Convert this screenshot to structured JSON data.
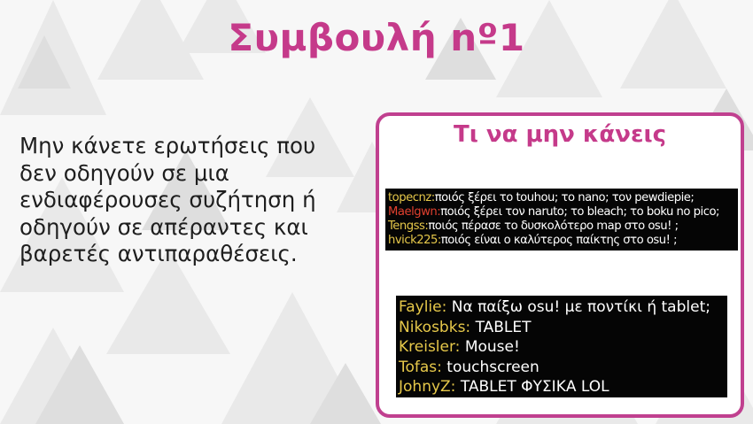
{
  "slide": {
    "title": "Συμβουλή nº1",
    "body_lines": [
      "Μην κάνετε ερωτήσεις που",
      "δεν οδηγούν σε μια",
      "ενδιαφέρουσες συζήτηση ή",
      "οδηγούν σε απέραντες και",
      "βαρετές αντιπαραθέσεις."
    ]
  },
  "panel": {
    "title": "Τι να μην κάνεις",
    "chat1": [
      {
        "user": "topecnz:",
        "color": "#e6c84a",
        "message": "ποιός ξέρει το touhou; το nano; τον pewdiepie;"
      },
      {
        "user": "Maelgwn:",
        "color": "#e0402f",
        "message": "ποιός ξέρει τον naruto; το bleach; το boku no pico;"
      },
      {
        "user": "Tengss:",
        "color": "#e6c84a",
        "message": "ποιός πέρασε το δυσκολότερο map στο osu! ;"
      },
      {
        "user": "hvick225:",
        "color": "#e6c84a",
        "message": "ποιός είναι ο καλύτερος παίκτης στο osu! ;"
      }
    ],
    "chat2": [
      {
        "user": "Faylie:",
        "color": "#e6c84a",
        "message": "Να παίξω osu! με ποντίκι ή tablet;"
      },
      {
        "user": "Nikosbks:",
        "color": "#e6c84a",
        "message": "TABLET"
      },
      {
        "user": "Kreisler:",
        "color": "#e6c84a",
        "message": "Mouse!"
      },
      {
        "user": "Tofas:",
        "color": "#e6c84a",
        "message": "touchscreen"
      },
      {
        "user": "JohnyZ:",
        "color": "#e6c84a",
        "message": "TABLET ΦΥΣΙΚΑ LOL"
      }
    ]
  },
  "colors": {
    "accent": "#c53a8a",
    "panel_border": "#c0408f",
    "chat_bg": "#050505"
  }
}
